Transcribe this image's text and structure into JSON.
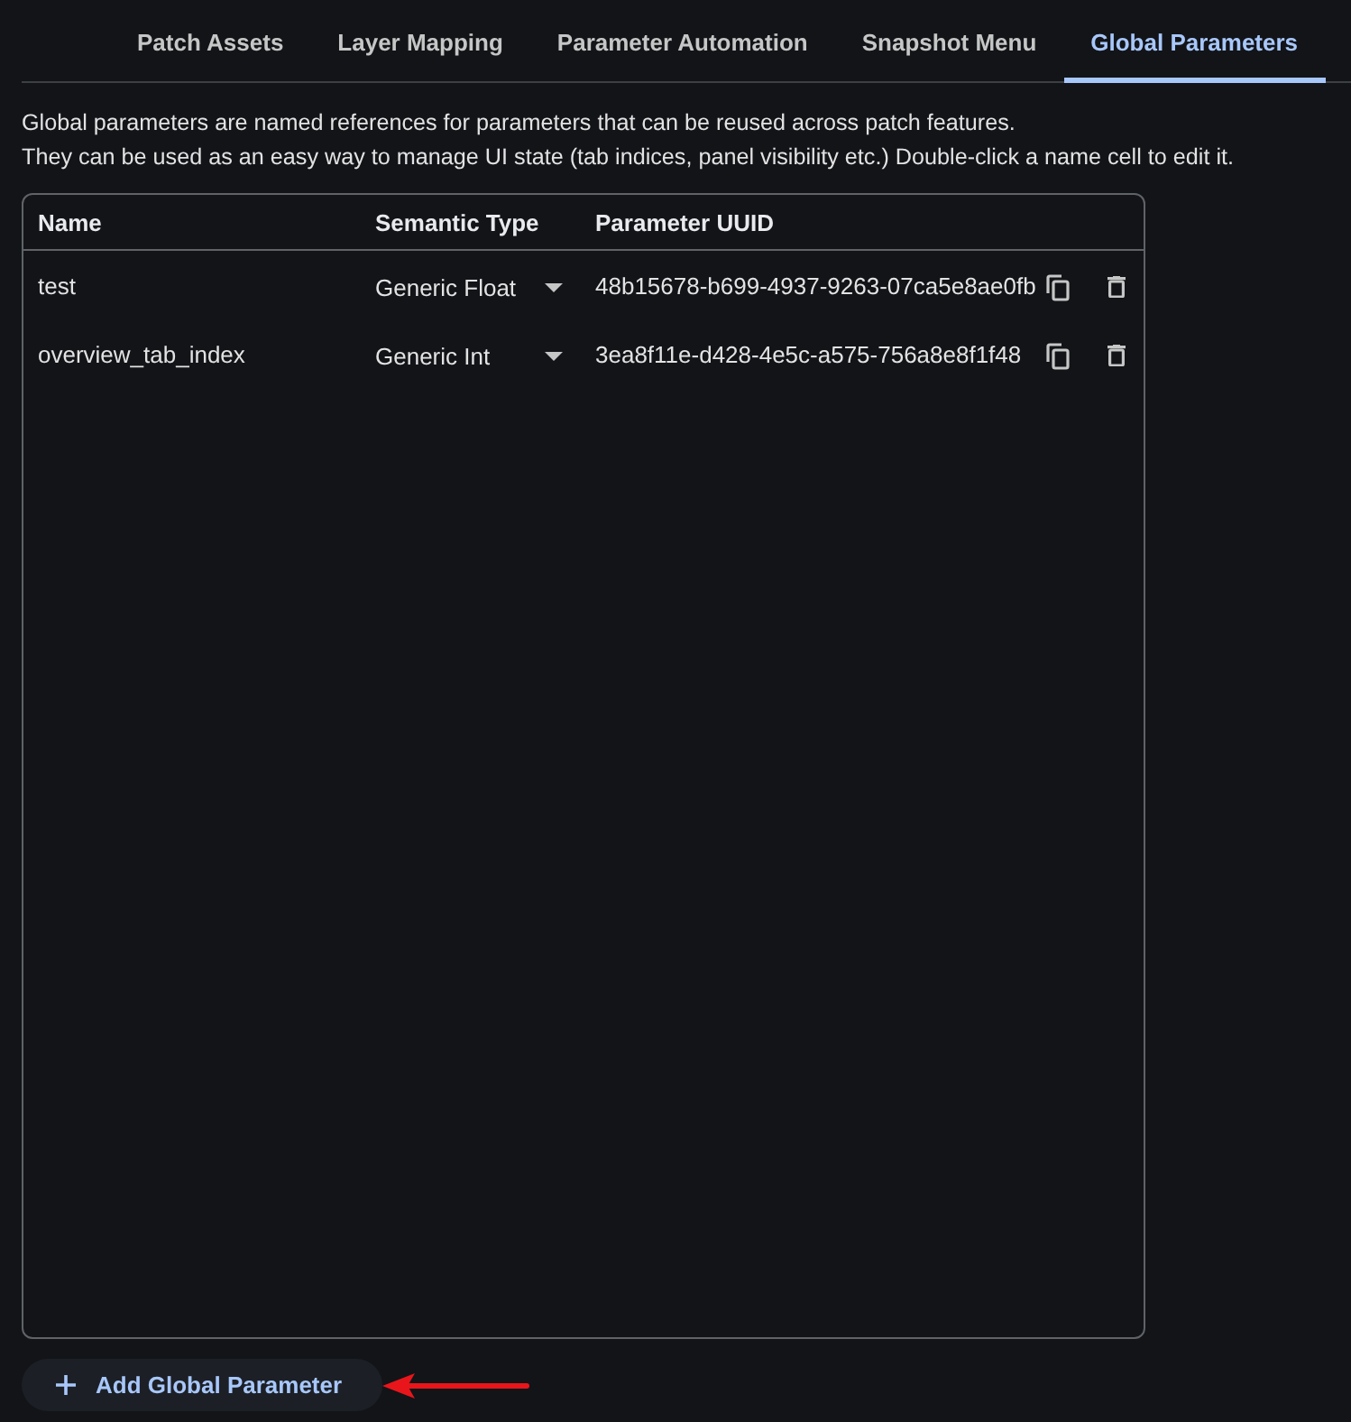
{
  "tabs": [
    {
      "label": "Patch Assets",
      "selected": false
    },
    {
      "label": "Layer Mapping",
      "selected": false
    },
    {
      "label": "Parameter Automation",
      "selected": false
    },
    {
      "label": "Snapshot Menu",
      "selected": false
    },
    {
      "label": "Global Parameters",
      "selected": true
    }
  ],
  "description": [
    "Global parameters are named references for parameters that can be reused across patch features.",
    "They can be used as an easy way to manage UI state (tab indices, panel visibility etc.) Double-click a name cell to edit it."
  ],
  "table": {
    "columns": [
      "Name",
      "Semantic Type",
      "Parameter UUID"
    ],
    "rows": [
      {
        "name": "test",
        "semantic_type": "Generic Float",
        "uuid": "48b15678-b699-4937-9263-07ca5e8ae0fb"
      },
      {
        "name": "overview_tab_index",
        "semantic_type": "Generic Int",
        "uuid": "3ea8f11e-d428-4e5c-a575-756a8e8f1f48"
      }
    ]
  },
  "add_button": {
    "label": "Add Global Parameter"
  }
}
